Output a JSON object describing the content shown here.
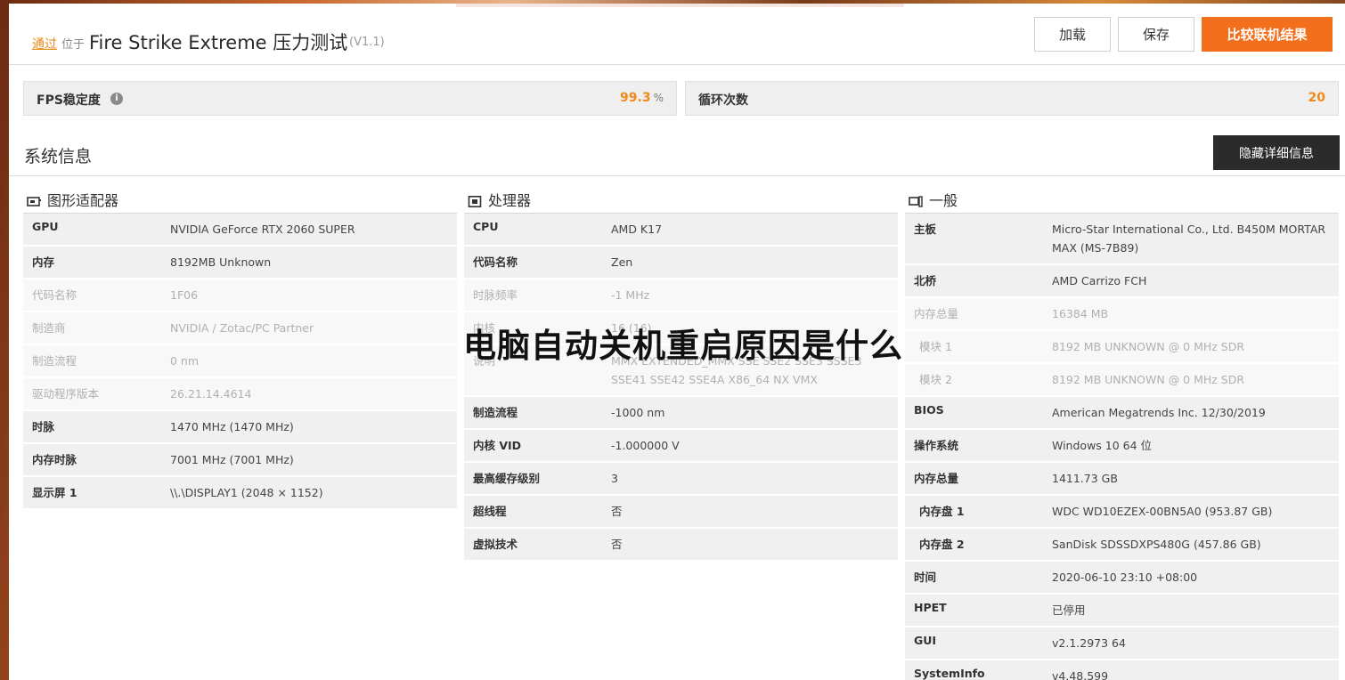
{
  "header": {
    "pass_label": "通过",
    "at_label": "位于",
    "title": "Fire Strike Extreme 压力测试",
    "version": "(V1.1)",
    "load_label": "加载",
    "save_label": "保存",
    "compare_label": "比较联机结果"
  },
  "stats": {
    "fps_label": "FPS稳定度",
    "fps_value": "99.3",
    "fps_unit": "%",
    "loops_label": "循环次数",
    "loops_value": "20"
  },
  "system": {
    "title": "系统信息",
    "hide_label": "隐藏详细信息"
  },
  "gpu": {
    "heading": "图形适配器",
    "rows": [
      {
        "k": "GPU",
        "v": "NVIDIA GeForce RTX 2060 SUPER"
      },
      {
        "k": "内存",
        "v": "8192MB Unknown"
      },
      {
        "k": "代码名称",
        "v": "1F06"
      },
      {
        "k": "制造商",
        "v": "NVIDIA / Zotac/PC Partner"
      },
      {
        "k": "制造流程",
        "v": "0 nm"
      },
      {
        "k": "驱动程序版本",
        "v": "26.21.14.4614"
      },
      {
        "k": "时脉",
        "v": "1470 MHz (1470 MHz)"
      },
      {
        "k": "内存时脉",
        "v": "7001 MHz (7001 MHz)"
      },
      {
        "k": "显示屏 1",
        "v": "\\\\.\\DISPLAY1 (2048 × 1152)"
      }
    ]
  },
  "cpu": {
    "heading": "处理器",
    "rows": [
      {
        "k": "CPU",
        "v": "AMD K17"
      },
      {
        "k": "代码名称",
        "v": "Zen"
      },
      {
        "k": "时脉频率",
        "v": "-1 MHz"
      },
      {
        "k": "内核",
        "v": "16 (16)"
      },
      {
        "k": "说明",
        "v": "MMX EXTENDED_MMX SSE SSE2 SSE3 SSSE3 SSE41 SSE42 SSE4A X86_64 NX VMX"
      },
      {
        "k": "制造流程",
        "v": "-1000 nm"
      },
      {
        "k": "内核 VID",
        "v": "-1.000000 V"
      },
      {
        "k": "最高缓存级别",
        "v": "3"
      },
      {
        "k": "超线程",
        "v": "否"
      },
      {
        "k": "虚拟技术",
        "v": "否"
      }
    ]
  },
  "general": {
    "heading": "一般",
    "rows": [
      {
        "k": "主板",
        "v": "Micro-Star International Co., Ltd. B450M MORTAR MAX (MS-7B89)"
      },
      {
        "k": "北桥",
        "v": "AMD Carrizo FCH"
      },
      {
        "k": "内存总量",
        "v": "16384 MB"
      },
      {
        "k": "模块 1",
        "v": "8192 MB UNKNOWN @ 0 MHz SDR"
      },
      {
        "k": "模块 2",
        "v": "8192 MB UNKNOWN @ 0 MHz SDR"
      },
      {
        "k": "BIOS",
        "v": "American Megatrends Inc. 12/30/2019"
      },
      {
        "k": "操作系统",
        "v": "Windows 10 64 位"
      },
      {
        "k": "内存总量",
        "v": "1411.73 GB"
      },
      {
        "k": "内存盘 1",
        "v": "WDC WD10EZEX-00BN5A0 (953.87 GB)"
      },
      {
        "k": "内存盘 2",
        "v": "SanDisk SDSSDXPS480G (457.86 GB)"
      },
      {
        "k": "时间",
        "v": "2020-06-10 23:10 +08:00"
      },
      {
        "k": "HPET",
        "v": "已停用"
      },
      {
        "k": "GUI",
        "v": "v2.1.2973 64"
      },
      {
        "k": "SystemInfo",
        "v": "v4.48.599"
      }
    ]
  },
  "overlay": {
    "title": "电脑自动关机重启原因是什么"
  }
}
